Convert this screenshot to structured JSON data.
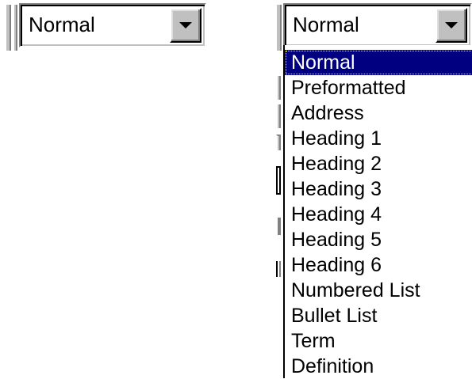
{
  "left_combo": {
    "value": "Normal"
  },
  "right_combo": {
    "value": "Normal"
  },
  "dropdown": {
    "items": [
      {
        "label": "Normal",
        "selected": true
      },
      {
        "label": "Preformatted",
        "selected": false
      },
      {
        "label": "Address",
        "selected": false
      },
      {
        "label": "Heading 1",
        "selected": false
      },
      {
        "label": "Heading 2",
        "selected": false
      },
      {
        "label": "Heading 3",
        "selected": false
      },
      {
        "label": "Heading 4",
        "selected": false
      },
      {
        "label": "Heading 5",
        "selected": false
      },
      {
        "label": "Heading 6",
        "selected": false
      },
      {
        "label": "Numbered List",
        "selected": false
      },
      {
        "label": "Bullet List",
        "selected": false
      },
      {
        "label": "Term",
        "selected": false
      },
      {
        "label": "Definition",
        "selected": false
      }
    ]
  },
  "colors": {
    "face": "#c0c0c0",
    "highlight": "#000080",
    "highlight_text": "#ffffff"
  },
  "icons": {
    "combo_button": "chevron-down-icon"
  }
}
